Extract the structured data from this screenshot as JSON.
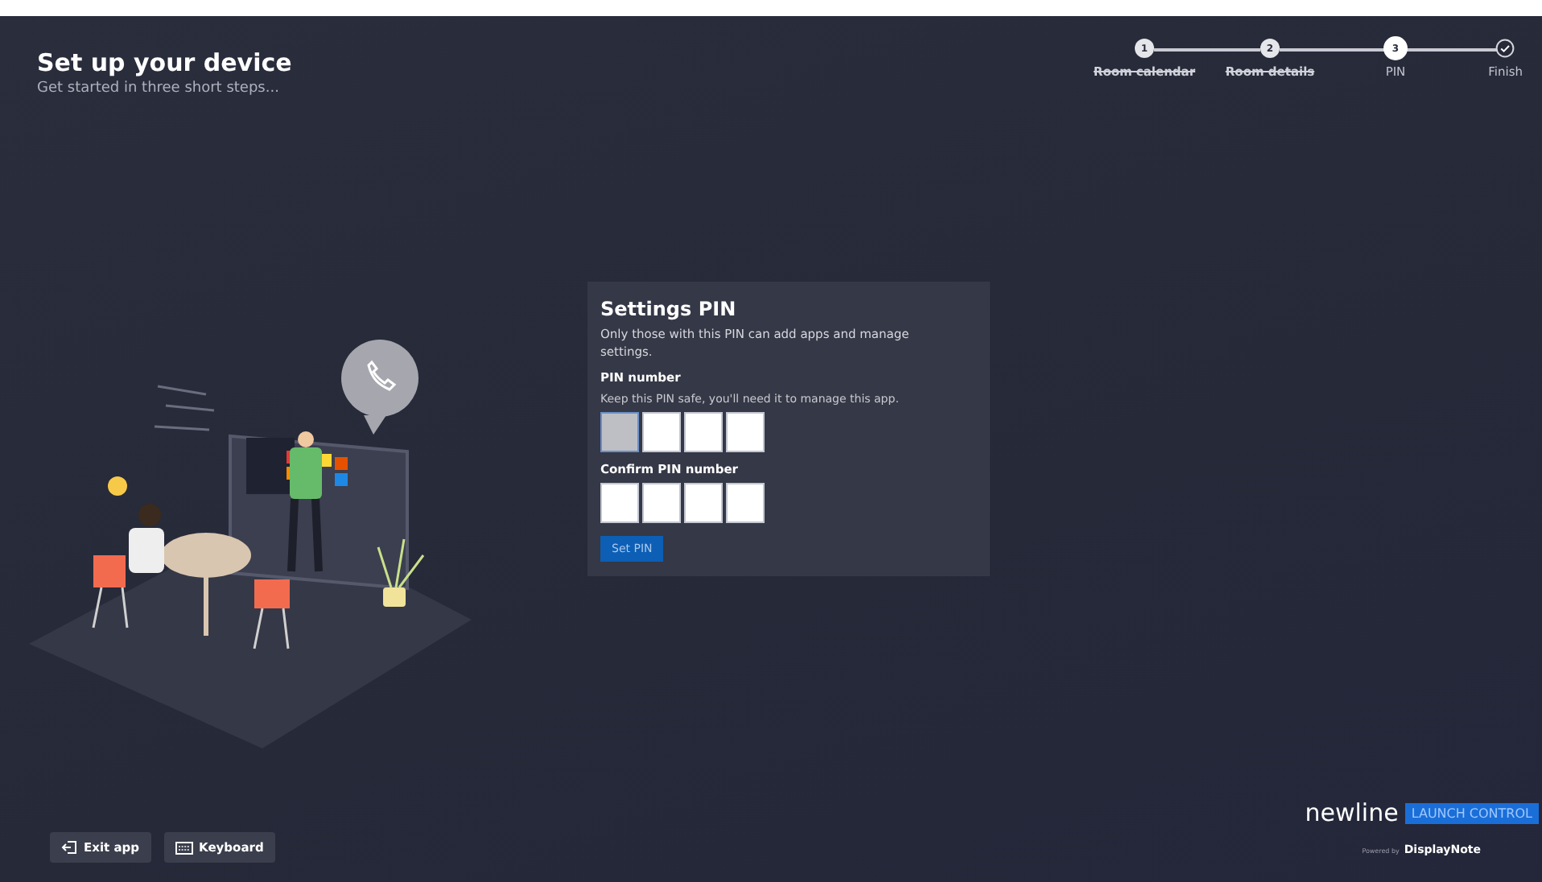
{
  "header": {
    "title": "Set up your device",
    "subtitle": "Get started in three short steps..."
  },
  "steps": [
    {
      "kind": "number",
      "marker": "1",
      "label": "Room calendar",
      "completed": true,
      "selected": false
    },
    {
      "kind": "number",
      "marker": "2",
      "label": "Room details",
      "completed": true,
      "selected": false
    },
    {
      "kind": "number",
      "marker": "3",
      "label": "PIN",
      "completed": false,
      "selected": true
    },
    {
      "kind": "check",
      "label": "Finish",
      "completed": false,
      "selected": false
    }
  ],
  "card": {
    "title": "Settings PIN",
    "description": "Only those with this PIN can add apps and manage settings.",
    "pin": {
      "label": "PIN number",
      "hint": "Keep this PIN safe, you'll need it to manage this app.",
      "digits": [
        {
          "focused": true
        },
        {
          "focused": false
        },
        {
          "focused": false
        },
        {
          "focused": false
        }
      ]
    },
    "confirm": {
      "label": "Confirm PIN number",
      "digits": [
        {
          "focused": false
        },
        {
          "focused": false
        },
        {
          "focused": false
        },
        {
          "focused": false
        }
      ]
    },
    "button": {
      "label": "Set PIN",
      "disabled": true
    }
  },
  "footer_buttons": [
    {
      "kind": "exit",
      "label": "Exit app"
    },
    {
      "kind": "keyboard",
      "label": "Keyboard"
    }
  ],
  "branding": {
    "brand": "newline",
    "product": "LAUNCH CONTROL",
    "powered_by": "Powered by",
    "vendor": "DisplayNote"
  }
}
